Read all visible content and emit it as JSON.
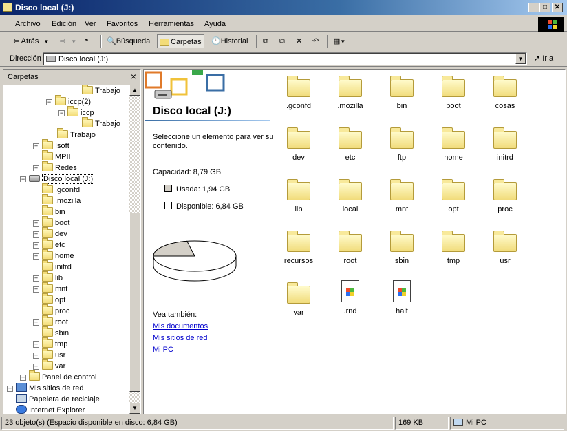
{
  "window": {
    "title": "Disco local (J:)"
  },
  "menu": [
    {
      "label": "Archivo"
    },
    {
      "label": "Edición"
    },
    {
      "label": "Ver"
    },
    {
      "label": "Favoritos"
    },
    {
      "label": "Herramientas"
    },
    {
      "label": "Ayuda"
    }
  ],
  "toolbar": {
    "back": "Atrás",
    "search": "Búsqueda",
    "folders": "Carpetas",
    "history": "Historial"
  },
  "address": {
    "label": "Dirección",
    "value": "Disco local (J:)",
    "go": "Ir a"
  },
  "leftpane": {
    "header": "Carpetas",
    "tree": [
      {
        "label": "Trabajo",
        "indent": 0
      },
      {
        "label": "iccp(2)",
        "indent": 0
      },
      {
        "label": "iccp",
        "indent": 0
      },
      {
        "label": "Trabajo",
        "indent": 0
      },
      {
        "label": "Trabajo",
        "indent": 0
      },
      {
        "label": "Isoft",
        "indent": 0
      },
      {
        "label": "MPII",
        "indent": 0
      },
      {
        "label": "Redes",
        "indent": 0
      },
      {
        "label": "Disco local (J:)",
        "indent": 0
      },
      {
        "label": ".gconfd"
      },
      {
        "label": ".mozilla"
      },
      {
        "label": "bin"
      },
      {
        "label": "boot"
      },
      {
        "label": "dev"
      },
      {
        "label": "etc"
      },
      {
        "label": "home"
      },
      {
        "label": "initrd"
      },
      {
        "label": "lib"
      },
      {
        "label": "mnt"
      },
      {
        "label": "opt"
      },
      {
        "label": "proc"
      },
      {
        "label": "root"
      },
      {
        "label": "sbin"
      },
      {
        "label": "tmp"
      },
      {
        "label": "usr"
      },
      {
        "label": "var"
      },
      {
        "label": "Panel de control"
      },
      {
        "label": "Mis sitios de red"
      },
      {
        "label": "Papelera de reciclaje"
      },
      {
        "label": "Internet Explorer"
      }
    ]
  },
  "details": {
    "title": "Disco local (J:)",
    "prompt": "Seleccione un elemento para ver su contenido.",
    "capacity": "Capacidad: 8,79 GB",
    "used": "Usada: 1,94 GB",
    "free": "Disponible: 6,84 GB",
    "used_fraction": 0.22,
    "see_also": "Vea también:",
    "links": [
      "Mis documentos",
      "Mis sitios de red",
      "Mi PC"
    ],
    "colors": {
      "used": "#d4d0c8",
      "free": "#ffffff"
    }
  },
  "items": [
    {
      "label": ".gconfd",
      "type": "folder"
    },
    {
      "label": ".mozilla",
      "type": "folder"
    },
    {
      "label": "bin",
      "type": "folder"
    },
    {
      "label": "boot",
      "type": "folder"
    },
    {
      "label": "cosas",
      "type": "folder"
    },
    {
      "label": "dev",
      "type": "folder"
    },
    {
      "label": "etc",
      "type": "folder"
    },
    {
      "label": "ftp",
      "type": "folder"
    },
    {
      "label": "home",
      "type": "folder"
    },
    {
      "label": "initrd",
      "type": "folder"
    },
    {
      "label": "lib",
      "type": "folder"
    },
    {
      "label": "local",
      "type": "folder"
    },
    {
      "label": "mnt",
      "type": "folder"
    },
    {
      "label": "opt",
      "type": "folder"
    },
    {
      "label": "proc",
      "type": "folder"
    },
    {
      "label": "recursos",
      "type": "folder"
    },
    {
      "label": "root",
      "type": "folder"
    },
    {
      "label": "sbin",
      "type": "folder"
    },
    {
      "label": "tmp",
      "type": "folder"
    },
    {
      "label": "usr",
      "type": "folder"
    },
    {
      "label": "var",
      "type": "folder"
    },
    {
      "label": ".rnd",
      "type": "file"
    },
    {
      "label": "halt",
      "type": "file"
    }
  ],
  "status": {
    "objects": "23 objeto(s) (Espacio disponible en disco: 6,84 GB)",
    "size": "169 KB",
    "location": "Mi PC"
  }
}
